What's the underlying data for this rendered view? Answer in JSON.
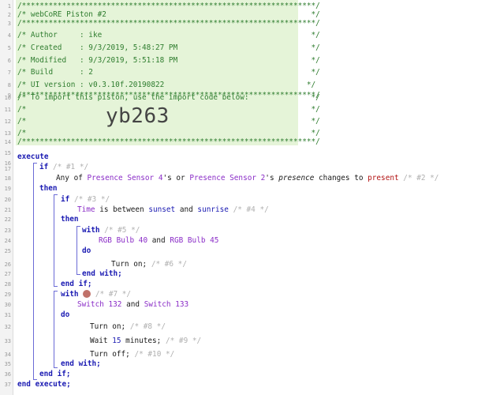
{
  "line_numbers": [
    "1",
    "2",
    "3",
    "4",
    "5",
    "6",
    "7",
    "8",
    "9",
    "10",
    "11",
    "12",
    "13",
    "14",
    "15",
    "16",
    "17",
    "18",
    "19",
    "20",
    "21",
    "22",
    "23",
    "24",
    "25",
    "26",
    "27",
    "28",
    "29",
    "30",
    "31",
    "32",
    "33",
    "34",
    "35",
    "36",
    "37"
  ],
  "header_comment": {
    "rule": "/******************************************************************/",
    "title": "/* webCoRE Piston #2                                              */",
    "author": "/* Author     : ike                                               */",
    "created": "/* Created    : 9/3/2019, 5:48:27 PM                              */",
    "modified": "/* Modified   : 9/3/2019, 5:51:18 PM                              */",
    "build": "/* Build      : 2                                                 */",
    "ui_version": "/* UI version : v0.3.10f.20190822                                */",
    "import_note": "/* To import this piston, use the import code below:              */",
    "blank": "/*                                                                */",
    "import_code": "yb263"
  },
  "code": {
    "execute": "execute",
    "if1": "if",
    "if1_comment": "/* #1 */",
    "cond1_prefix": "Any of ",
    "device1": "Presence Sensor 4",
    "cond1_mid": "'s or ",
    "device2": "Presence Sensor 2",
    "cond1_poss": "'s ",
    "attr1": "presence",
    "cond1_changes": " changes to ",
    "value1": "present",
    "cond1_comment": "/* #2 */",
    "then1": "then",
    "if2": "if",
    "if2_comment": "/* #3 */",
    "time_fn": "Time",
    "cond2_mid": " is between ",
    "sunset": "sunset",
    "cond2_and": " and ",
    "sunrise": "sunrise",
    "cond2_comment": "/* #4 */",
    "then2": "then",
    "with1": "with",
    "with1_comment": "/* #5 */",
    "bulb40": "RGB Bulb 40",
    "and": " and ",
    "bulb45": "RGB Bulb 45",
    "do1": "do",
    "turn_on1": "Turn on;",
    "turn_on1_comment": "/* #6 */",
    "end_with1": "end with;",
    "end_if2": "end if;",
    "with2": "with",
    "with2_comment": "/* #7 */",
    "switch132": "Switch 132",
    "switch133": "Switch 133",
    "do2": "do",
    "turn_on2": "Turn on;",
    "turn_on2_comment": "/* #8 */",
    "wait_prefix": "Wait ",
    "wait_value": "15",
    "wait_suffix": " minutes;",
    "wait_comment": "/* #9 */",
    "turn_off": "Turn off;",
    "turn_off_comment": "/* #10 */",
    "end_with2": "end with;",
    "end_if1": "end if;",
    "end_execute": "end execute;"
  },
  "colors": {
    "comment_bg": "#e5f4d8",
    "comment_text": "#2f7d2f",
    "keyword": "#1a1ab2",
    "device": "#8a2cc7",
    "value": "#b21212"
  }
}
